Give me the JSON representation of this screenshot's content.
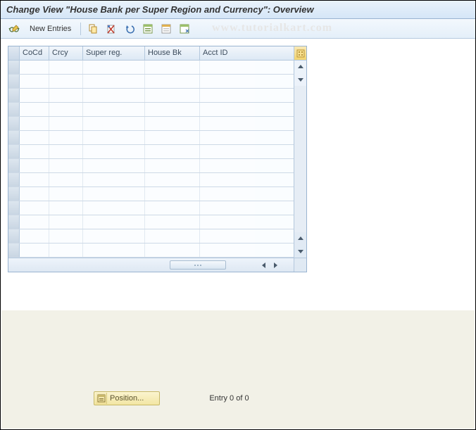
{
  "title": "Change View \"House Bank per Super Region and Currency\": Overview",
  "watermark": "www.tutorialkart.com",
  "toolbar": {
    "new_entries_label": "New Entries"
  },
  "table": {
    "columns": {
      "cocd": "CoCd",
      "crcy": "Crcy",
      "super_reg": "Super reg.",
      "house_bk": "House Bk",
      "acct_id": "Acct ID"
    },
    "row_count": 14,
    "rows": []
  },
  "footer": {
    "position_label": "Position...",
    "entry_text": "Entry 0 of 0"
  }
}
